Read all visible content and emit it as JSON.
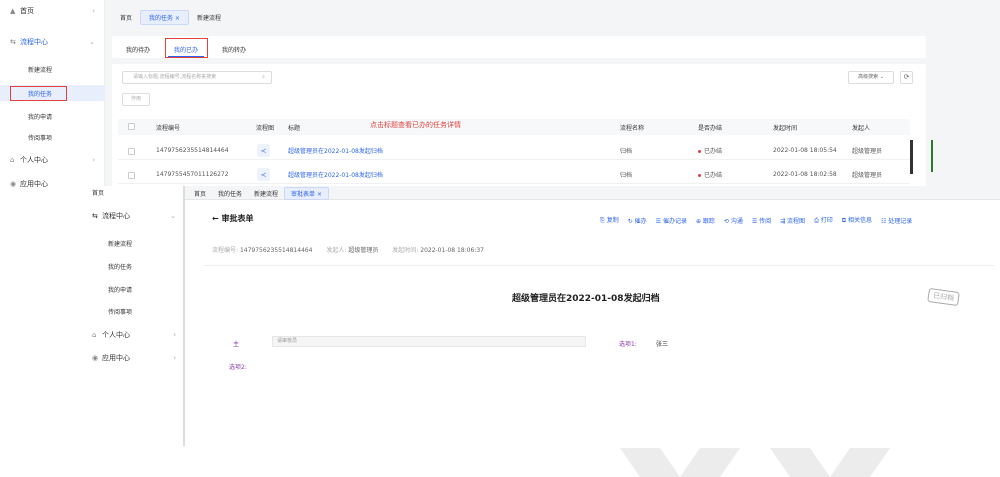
{
  "back": {
    "sidebar": [
      {
        "icon": "▲",
        "label": "首页",
        "chev": "›"
      },
      {
        "icon": "⇆",
        "label": "流程中心",
        "chev": "⌄",
        "blue": true
      },
      {
        "icon": "⌂",
        "label": "个人中心",
        "chev": "›"
      },
      {
        "icon": "◉",
        "label": "应用中心",
        "chev": "›"
      }
    ],
    "flow_sub": [
      "新建流程",
      "我的任务",
      "我的申请",
      "传阅事项"
    ],
    "tabs": [
      "首页",
      "我的任务 ×",
      "新建流程"
    ],
    "subtabs": [
      "我的待办",
      "我的已办",
      "我的转办"
    ],
    "search_placeholder": "请输入标题,流程编号,流程名称来搜索",
    "advanced_search": "高级搜索 ⌄",
    "delete_button": "作用",
    "annotation": "点击标题查看已办的任务详情",
    "columns": [
      "流程编号",
      "流程图",
      "标题",
      "流程名称",
      "是否办结",
      "发起时间",
      "发起人"
    ],
    "rows": [
      {
        "id": "1479756235514814464",
        "title": "超级管理员在2022-01-08发起归档",
        "flow": "归档",
        "status": "已办结",
        "time": "2022-01-08 18:05:54",
        "user": "超级管理员"
      },
      {
        "id": "1479755457011126272",
        "title": "超级管理员在2022-01-08发起归档",
        "flow": "归档",
        "status": "已办结",
        "time": "2022-01-08 18:02:58",
        "user": "超级管理员"
      }
    ]
  },
  "front": {
    "sidebar": [
      {
        "label": "首页"
      },
      {
        "icon": "⇆",
        "label": "流程中心",
        "chev": "⌄"
      },
      {
        "icon": "⌂",
        "label": "个人中心",
        "chev": "›"
      },
      {
        "icon": "◉",
        "label": "应用中心",
        "chev": "›"
      }
    ],
    "flow_sub": [
      "新建流程",
      "我的任务",
      "我的申请",
      "传阅事项"
    ],
    "tabs": [
      "首页",
      "我的任务",
      "新建流程",
      "审批表单 ×"
    ],
    "back_title": "← 审批表单",
    "toolbar": [
      "⎘ 复制",
      "↻ 催办",
      "☰ 催办记录",
      "⊕ 跟踪",
      "⟲ 沟通",
      "☰ 传阅",
      "⇶ 流程图",
      "⎙ 打印",
      "⧉ 相关信息",
      "☷ 处理记录"
    ],
    "meta_id_label": "流程编号:",
    "meta_id": "1479756235514814464",
    "meta_user_label": "发起人:",
    "meta_user": "超级管理员",
    "meta_time_label": "发起时间:",
    "meta_time": "2022-01-08 18:06:37",
    "form_title": "超级管理员在2022-01-08发起归档",
    "stamp": "已归档",
    "field_main_label": "主",
    "field_main_value": "请审核员",
    "option1_label": "选项1:",
    "option1_value": "张三",
    "option2_label": "选项2:"
  },
  "colors": {
    "accent": "#2b63f0",
    "annotation": "#e0433c",
    "field": "#8a3aa8"
  }
}
